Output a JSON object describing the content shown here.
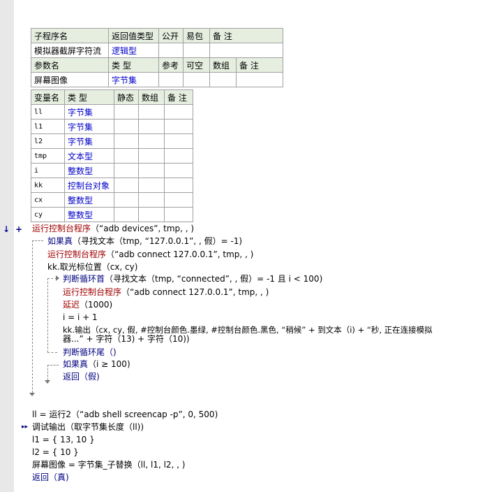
{
  "sub_table": {
    "headers": [
      "子程序名",
      "返回值类型",
      "公开",
      "易包",
      "备 注"
    ],
    "row": [
      "模拟器截屏字符流",
      "逻辑型",
      "",
      "",
      ""
    ],
    "param_headers": [
      "参数名",
      "类 型",
      "参考",
      "可空",
      "数组",
      "备 注"
    ],
    "param_row": [
      "屏幕图像",
      "字节集",
      "",
      "",
      "",
      ""
    ]
  },
  "var_table": {
    "headers": [
      "变量名",
      "类 型",
      "静态",
      "数组",
      "备 注"
    ],
    "rows": [
      [
        "ll",
        "字节集"
      ],
      [
        "l1",
        "字节集"
      ],
      [
        "l2",
        "字节集"
      ],
      [
        "tmp",
        "文本型"
      ],
      [
        "i",
        "整数型"
      ],
      [
        "kk",
        "控制台对象"
      ],
      [
        "cx",
        "整数型"
      ],
      [
        "cy",
        "整数型"
      ]
    ]
  },
  "code": {
    "l1": {
      "fn": "运行控制台程序",
      "rest": "（“adb devices”, tmp, , )"
    },
    "l2": {
      "kw": "如果真",
      "rest": "（寻找文本（tmp, “127.0.0.1”, , 假）= -1)"
    },
    "l3": {
      "fn": "运行控制台程序",
      "rest": "（“adb connect 127.0.0.1”, tmp, , )"
    },
    "l4": "kk.取光标位置（cx, cy)",
    "l5": {
      "kw": "判断循环首",
      "rest": "（寻找文本（tmp, “connected”, , 假）= -1 且 i < 100)"
    },
    "l6": {
      "fn": "运行控制台程序",
      "rest": "（“adb connect 127.0.0.1”, tmp, , )"
    },
    "l7": {
      "fn": "延迟",
      "rest": "（1000)"
    },
    "l8": "i = i + 1",
    "l9a": "kk.输出（cx, cy, 假, #控制台颜色.墨绿, #控制台颜色.黑色, “稍候” + 到文本（i) + “秒, 正在连接模拟",
    "l9b": "器...” + 字符（13) + 字符（10))",
    "l10": "判断循环尾（)",
    "l11": {
      "kw": "如果真",
      "rest": "（i ≥ 100)"
    },
    "l12": "返回（假)",
    "l13": "ll = 运行2（“adb shell screencap -p”, 0, 500)",
    "l14": "调试输出（取字节集长度（ll))",
    "l15": "l1 = { 13, 10 }",
    "l16": "l2 = { 10 }",
    "l17": "屏幕图像 = 字节集_子替换（ll, l1, l2, , )",
    "l18": "返回（真)"
  },
  "icons": {
    "down_arrow": "↓",
    "plus": "+",
    "breakpoint": "▸▸"
  }
}
